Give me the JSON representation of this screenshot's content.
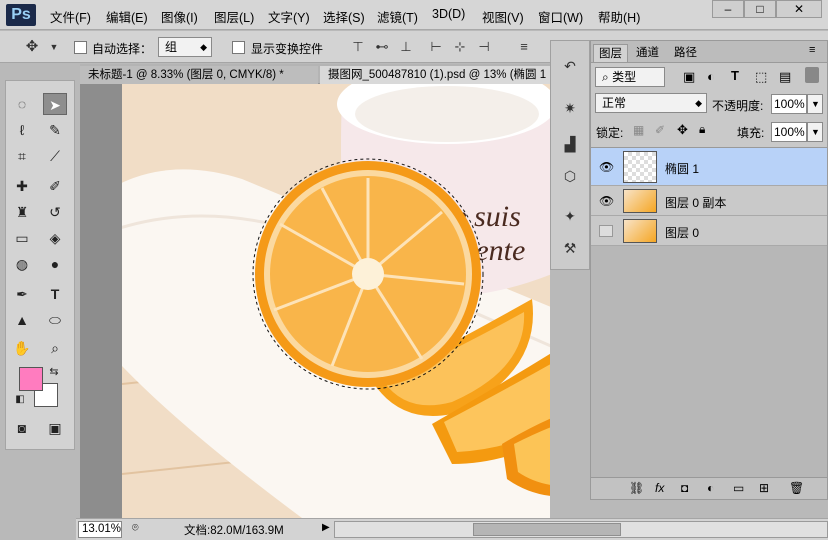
{
  "app": {
    "logo": "Ps",
    "menus": [
      "文件(F)",
      "编辑(E)",
      "图像(I)",
      "图层(L)",
      "文字(Y)",
      "选择(S)",
      "滤镜(T)",
      "3D(D)",
      "视图(V)",
      "窗口(W)",
      "帮助(H)"
    ],
    "window_buttons": {
      "minimize": "–",
      "restore": "□",
      "close": "✕"
    }
  },
  "options_bar": {
    "auto_select_label": "自动选择：",
    "auto_select_target": "组",
    "show_transform_label": "显示变换控件"
  },
  "documents": {
    "tabs": [
      {
        "title": "未标题-1 @ 8.33% (图层 0, CMYK/8) *",
        "active": false
      },
      {
        "title": "摄图网_500487810 (1).psd @ 13% (椭圆 1",
        "active": true
      }
    ],
    "canvas_text": "Je suis\ncontente"
  },
  "status": {
    "zoom": "13.01%",
    "doc_info": "文档:82.0M/163.9M"
  },
  "layers_panel": {
    "tabs": [
      "图层",
      "通道",
      "路径"
    ],
    "filter_kind": "类型",
    "blend_mode": "正常",
    "opacity_label": "不透明度:",
    "opacity_value": "100%",
    "lock_label": "锁定:",
    "fill_label": "填充:",
    "fill_value": "100%",
    "layers": [
      {
        "name": "椭圆 1",
        "visible": true,
        "selected": true
      },
      {
        "name": "图层 0 副本",
        "visible": true,
        "selected": false
      },
      {
        "name": "图层 0",
        "visible": false,
        "selected": false
      }
    ]
  },
  "colors": {
    "foreground": "#ff7cbf",
    "background": "#ffffff",
    "selection_highlight": "#b8d2f8"
  }
}
